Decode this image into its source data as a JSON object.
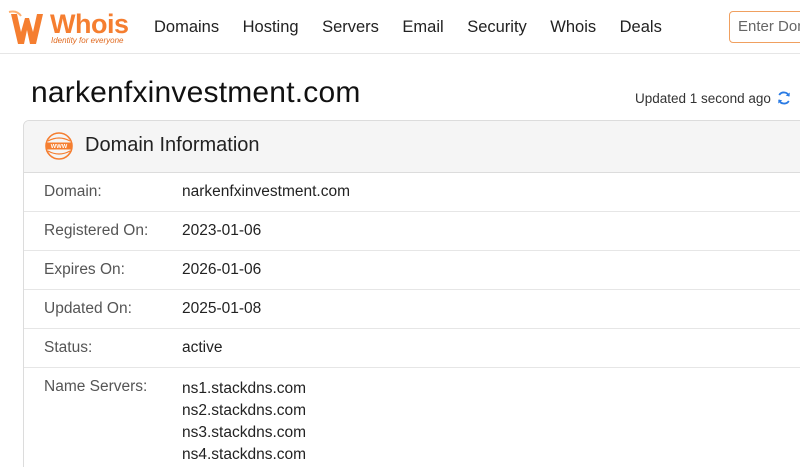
{
  "brand": {
    "name": "Whois",
    "tagline": "Identity for everyone",
    "accent": "#f57e30"
  },
  "nav": {
    "items": [
      "Domains",
      "Hosting",
      "Servers",
      "Email",
      "Security",
      "Whois",
      "Deals"
    ]
  },
  "search": {
    "placeholder": "Enter Domain"
  },
  "page": {
    "title": "narkenfxinvestment.com",
    "updated": "Updated 1 second ago"
  },
  "card": {
    "title": "Domain Information",
    "icon": "www-icon",
    "rows": [
      {
        "label": "Domain:",
        "value": "narkenfxinvestment.com"
      },
      {
        "label": "Registered On:",
        "value": "2023-01-06"
      },
      {
        "label": "Expires On:",
        "value": "2026-01-06"
      },
      {
        "label": "Updated On:",
        "value": "2025-01-08"
      },
      {
        "label": "Status:",
        "value": "active"
      }
    ],
    "name_servers": {
      "label": "Name Servers:",
      "values": [
        "ns1.stackdns.com",
        "ns2.stackdns.com",
        "ns3.stackdns.com",
        "ns4.stackdns.com"
      ]
    }
  }
}
